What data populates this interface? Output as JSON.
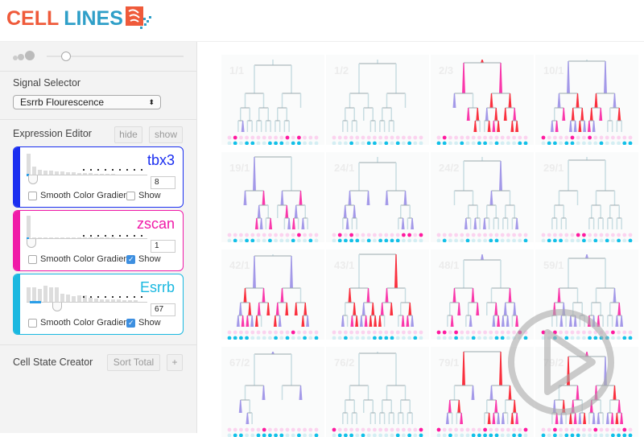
{
  "header": {
    "logo_part1": "CELL",
    "logo_part2": "LINES"
  },
  "sidebar": {
    "signal_selector": {
      "label": "Signal Selector",
      "value": "Esrrb Flourescence"
    },
    "expression_editor": {
      "label": "Expression Editor",
      "hide_label": "hide",
      "show_label": "show",
      "cards": [
        {
          "name": "tbx3",
          "color": "#1a2ef0",
          "threshold": "8",
          "smooth_label": "Smooth Color Gradient",
          "smooth": false,
          "show_label": "Show",
          "show": false
        },
        {
          "name": "zscan",
          "color": "#f01aa8",
          "threshold": "1",
          "smooth_label": "Smooth Color Gradient",
          "smooth": false,
          "show_label": "Show",
          "show": true
        },
        {
          "name": "Esrrb",
          "color": "#1ab8e0",
          "threshold": "67",
          "smooth_label": "Smooth Color Gradient",
          "smooth": false,
          "show_label": "Show",
          "show": true
        }
      ]
    },
    "cell_state_creator": {
      "label": "Cell State Creator",
      "sort_label": "Sort Total",
      "add_label": "+"
    }
  },
  "colors": {
    "pink": "#ff1aa0",
    "cyan": "#12c0e8",
    "lavender": "#9a8ce8",
    "red": "#ff1020"
  },
  "panels": [
    "1/1",
    "1/2",
    "2/3",
    "10/1",
    "19/1",
    "24/1",
    "24/2",
    "29/1",
    "42/1",
    "43/1",
    "48/1",
    "59/1",
    "67/2",
    "76/2",
    "79/1",
    "79/2"
  ],
  "overlay": {
    "icon": "play-icon"
  }
}
